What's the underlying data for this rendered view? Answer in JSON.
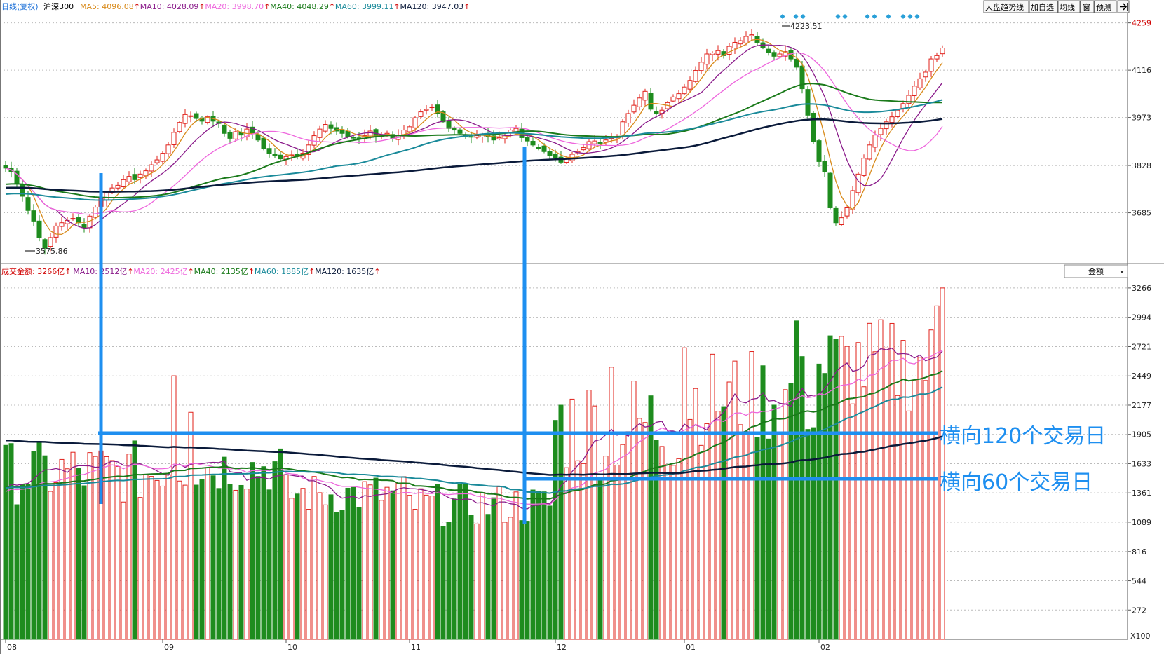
{
  "price_header": {
    "period": "日线(复权)",
    "index_name": "沪深300",
    "ma": [
      {
        "label": "MA5: 4096.08",
        "color": "#d88a1a"
      },
      {
        "label": "MA10: 4028.09",
        "color": "#8a1a8a"
      },
      {
        "label": "MA20: 3998.70",
        "color": "#ee66dd"
      },
      {
        "label": "MA40: 4048.29",
        "color": "#1a7a1a"
      },
      {
        "label": "MA60: 3999.11",
        "color": "#1a8a9a"
      },
      {
        "label": "MA120: 3947.03",
        "color": "#0a1a3a"
      }
    ]
  },
  "volume_header": {
    "label": "成交金额: 3266亿",
    "ma": [
      {
        "label": "MA10: 2512亿",
        "color": "#8a1a8a"
      },
      {
        "label": "MA20: 2425亿",
        "color": "#ee66dd"
      },
      {
        "label": "MA40: 2135亿",
        "color": "#1a7a1a"
      },
      {
        "label": "MA60: 1885亿",
        "color": "#1a8a9a"
      },
      {
        "label": "MA120: 1635亿",
        "color": "#0a1a3a"
      }
    ]
  },
  "toolbar": {
    "trend_line_label": "大盘趋势线",
    "add_watchlist_label": "加自选",
    "ma_line_label": "均线",
    "window_label": "窗",
    "forecast_label": "预测",
    "volume_select_label": "金额",
    "multiplier_label": "X100"
  },
  "annotations": {
    "horizontal_120": "横向120个交易日",
    "horizontal_60": "横向60个交易日"
  },
  "colors": {
    "up": "#e0201a",
    "down": "#1e8c1e",
    "annotation_blue": "#1e8ff0",
    "axis_text": "#222222"
  },
  "chart_data": [
    {
      "type": "candlestick",
      "title": "沪深300 日线(复权)",
      "y_ticks": [
        3685,
        3828,
        3973,
        4116,
        4259
      ],
      "ylim": [
        3540,
        4290
      ],
      "x_month_labels": [
        "08",
        "09",
        "10",
        "11",
        "12",
        "01",
        "02"
      ],
      "marked_high": "4223.51",
      "marked_low": "3575.86",
      "series": [
        {
          "name": "MA5",
          "value_last": 4096.08
        },
        {
          "name": "MA10",
          "value_last": 4028.09
        },
        {
          "name": "MA20",
          "value_last": 3998.7
        },
        {
          "name": "MA40",
          "value_last": 4048.29
        },
        {
          "name": "MA60",
          "value_last": 3999.11
        },
        {
          "name": "MA120",
          "value_last": 3947.03
        }
      ],
      "close": [
        3820,
        3810,
        3775,
        3735,
        3692,
        3660,
        3610,
        3578,
        3610,
        3645,
        3655,
        3662,
        3668,
        3655,
        3640,
        3675,
        3702,
        3728,
        3745,
        3760,
        3768,
        3785,
        3795,
        3785,
        3802,
        3812,
        3830,
        3845,
        3865,
        3890,
        3928,
        3958,
        3982,
        3978,
        3970,
        3962,
        3975,
        3962,
        3955,
        3925,
        3910,
        3930,
        3920,
        3938,
        3925,
        3905,
        3880,
        3865,
        3858,
        3848,
        3855,
        3860,
        3855,
        3865,
        3890,
        3918,
        3938,
        3952,
        3940,
        3932,
        3925,
        3915,
        3912,
        3908,
        3918,
        3932,
        3915,
        3920,
        3925,
        3910,
        3918,
        3935,
        3945,
        3972,
        3990,
        3998,
        4005,
        3985,
        3960,
        3940,
        3935,
        3925,
        3918,
        3915,
        3918,
        3922,
        3915,
        3905,
        3912,
        3920,
        3935,
        3940,
        3912,
        3902,
        3890,
        3880,
        3870,
        3858,
        3852,
        3838,
        3848,
        3862,
        3870,
        3882,
        3900,
        3902,
        3895,
        3905,
        3910,
        3915,
        3960,
        3985,
        4010,
        4032,
        4052,
        3998,
        3985,
        3995,
        4018,
        4035,
        4045,
        4065,
        4085,
        4115,
        4140,
        4165,
        4168,
        4175,
        4160,
        4188,
        4200,
        4205,
        4218,
        4223,
        4200,
        4185,
        4170,
        4158,
        4165,
        4172,
        4150,
        4125,
        4060,
        3980,
        3900,
        3840,
        3808,
        3700,
        3655,
        3670,
        3700,
        3752,
        3802,
        3850,
        3890,
        3920,
        3940,
        3960,
        3975,
        3995,
        4015,
        4040,
        4068,
        4090,
        4110,
        4150,
        4160,
        4183
      ],
      "volume_ticks": [
        272,
        544,
        816,
        1089,
        1361,
        1633,
        1905,
        2177,
        2449,
        2721,
        2994,
        3266
      ],
      "volume_last": 3266
    }
  ]
}
